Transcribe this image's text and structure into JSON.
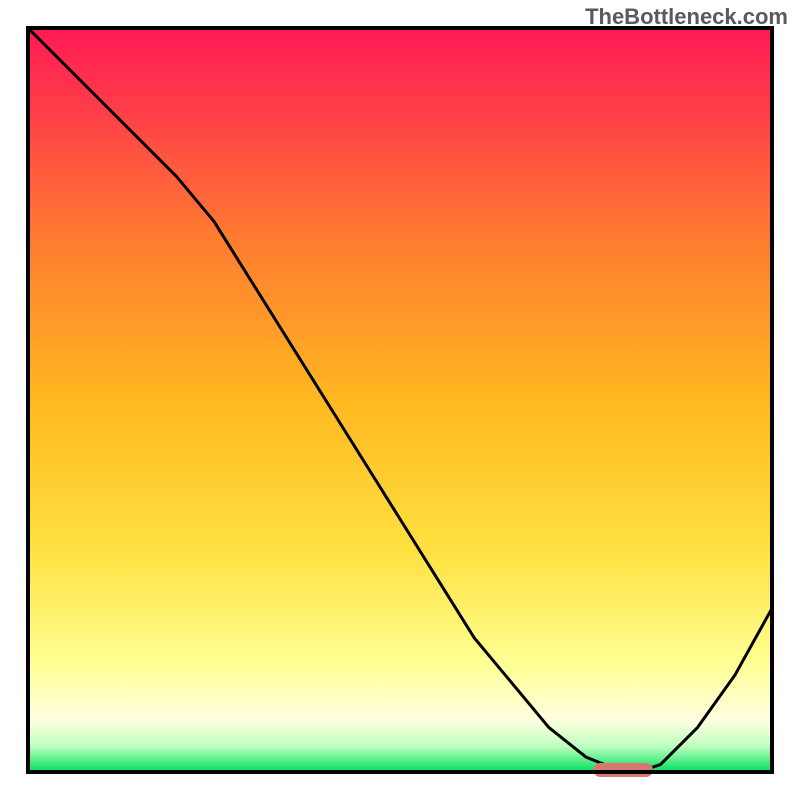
{
  "watermark": "TheBottleneck.com",
  "chart_data": {
    "type": "line",
    "title": "",
    "xlabel": "",
    "ylabel": "",
    "xlim": [
      0,
      100
    ],
    "ylim": [
      0,
      100
    ],
    "x": [
      0,
      5,
      10,
      15,
      20,
      25,
      30,
      35,
      40,
      45,
      50,
      55,
      60,
      65,
      70,
      75,
      80,
      82,
      85,
      90,
      95,
      100
    ],
    "values": [
      100,
      95,
      90,
      85,
      80,
      74,
      66,
      58,
      50,
      42,
      34,
      26,
      18,
      12,
      6,
      2,
      0,
      0,
      1,
      6,
      13,
      22
    ],
    "optimal_range_x": [
      76,
      84
    ],
    "optimal_y": 0,
    "description": "Bottleneck curve. X-axis represents a hardware balance parameter (0 to 100). Y-axis represents bottleneck percentage (0 worst at top, 100 best at bottom inverted — lower curve value means less bottleneck). The curve descends from top-left, reaches a minimum near x≈78–82 (the red marker / optimal point), then rises again toward the right edge. Background gradient encodes quality: green (bottom, good) → yellow → orange → red (top, bad)."
  },
  "colors": {
    "gradient_top": "#ff1a4a",
    "gradient_upper": "#ff5a3a",
    "gradient_mid": "#ffb020",
    "gradient_lower": "#ffe020",
    "gradient_pale": "#ffffc0",
    "gradient_bottom": "#00e060",
    "curve": "#000000",
    "frame": "#000000",
    "marker": "#d9776f"
  }
}
